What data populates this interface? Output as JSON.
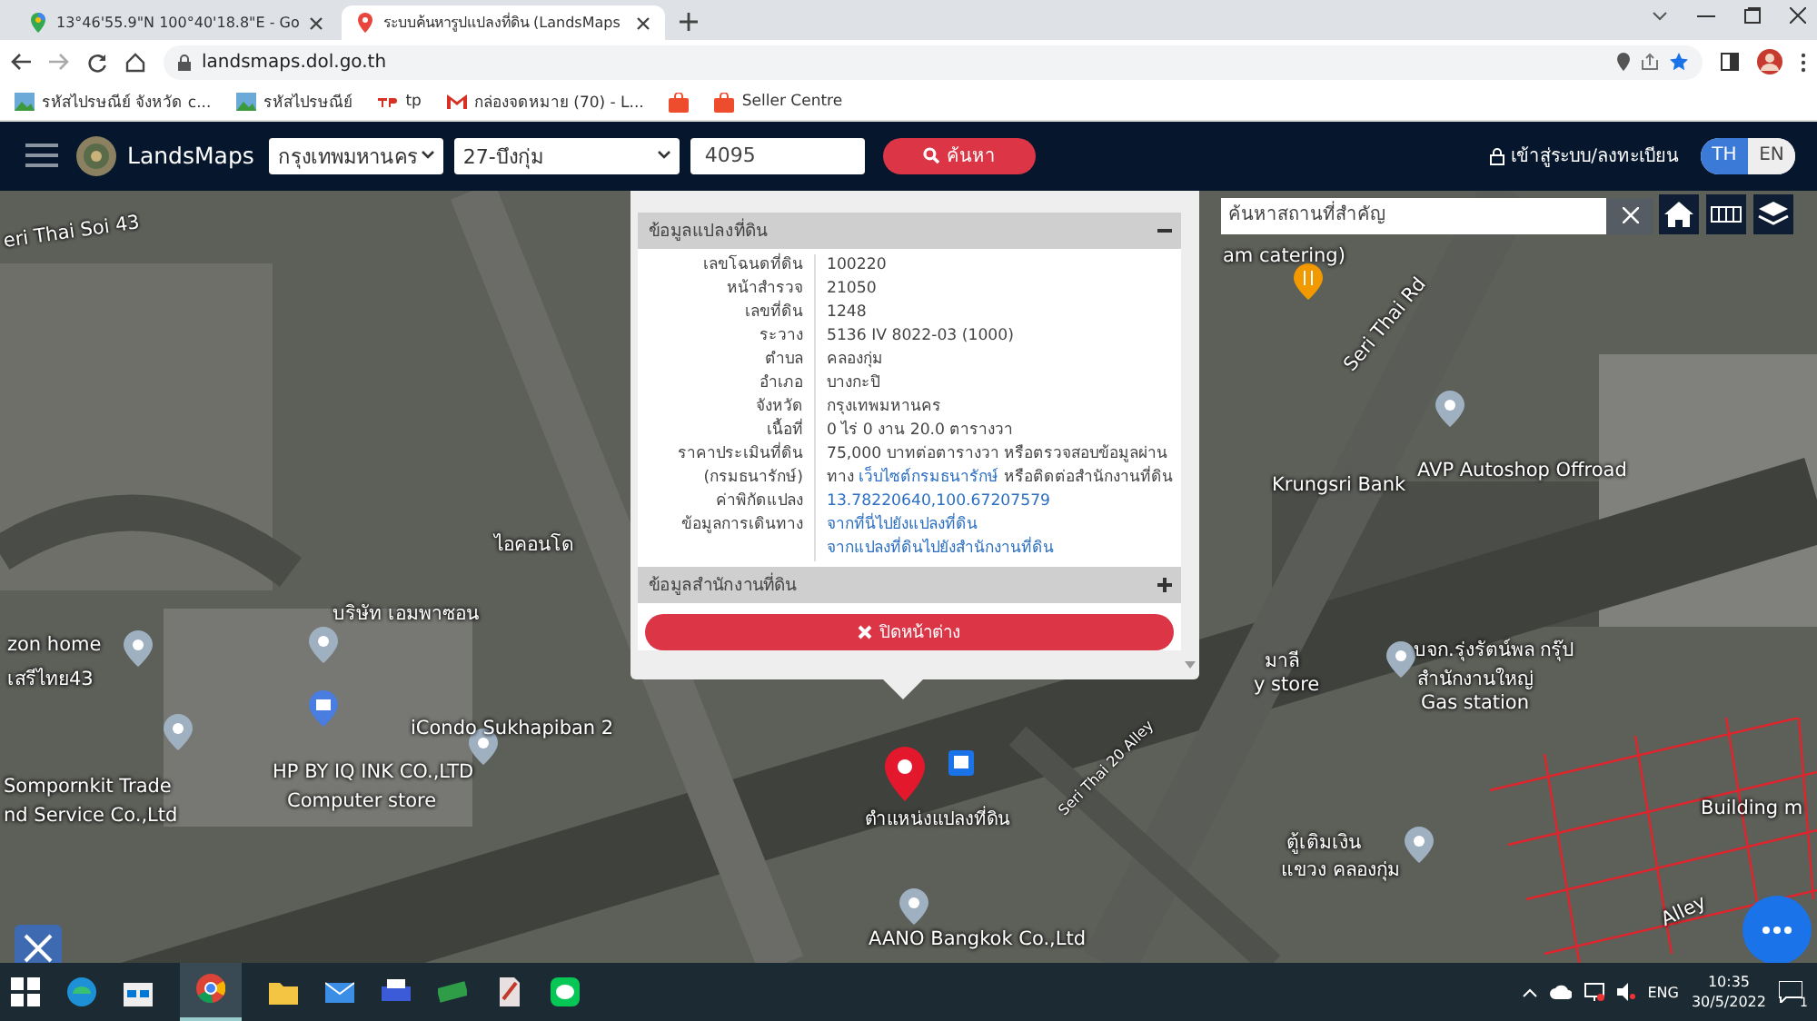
{
  "browser": {
    "tabs": [
      {
        "title": "13°46'55.9\"N 100°40'18.8\"E - Go",
        "selected": false
      },
      {
        "title": "ระบบค้นหารูปแปลงที่ดิน (LandsMaps",
        "selected": true
      }
    ],
    "url": "landsmaps.dol.go.th",
    "bookmarks": [
      {
        "label": "รหัสไปรษณีย์ จังหวัด c...",
        "kind": "image"
      },
      {
        "label": "รหัสไปรษณีย์",
        "kind": "image"
      },
      {
        "label": "tp",
        "kind": "tp"
      },
      {
        "label": "กล่องจดหมาย (70) - L...",
        "kind": "mail"
      },
      {
        "kind": "shop"
      },
      {
        "label": "Seller Centre",
        "kind": "shop"
      }
    ]
  },
  "app": {
    "brand": "LandsMaps",
    "province": "กรุงเทพมหานคร",
    "district": "27-บึงกุ่ม",
    "parcel_number": "4095",
    "search_button": "ค้นหา",
    "login": "เข้าสู่ระบบ/ลงทะเบียน",
    "languages": [
      {
        "label": "TH",
        "selected": true
      },
      {
        "label": "EN",
        "selected": false
      }
    ]
  },
  "map": {
    "search": {
      "placeholder": "ค้นหาสถานที่สำคัญ"
    },
    "labels": [
      {
        "text": "eri Thai Soi 43"
      },
      {
        "text": "am catering)"
      },
      {
        "text": "Seri Thai Rd"
      },
      {
        "text": "Krungsri Bank"
      },
      {
        "text": "AVP Autoshop Offroad"
      },
      {
        "text": "ไอคอนโด"
      },
      {
        "text": "บริษัท เอมพาซอน"
      },
      {
        "text": "zon home"
      },
      {
        "text": "เสรีไทย43"
      },
      {
        "text": "iCondo Sukhapiban 2"
      },
      {
        "text": "HP BY IQ INK CO.,LTD"
      },
      {
        "text": "Computer store"
      },
      {
        "text": "Sompornkit Trade"
      },
      {
        "text": "nd Service Co.,Ltd"
      },
      {
        "text": "มาลี"
      },
      {
        "text": "y store"
      },
      {
        "text": "บจก.รุ่งรัตน์พล กรุ๊ป"
      },
      {
        "text": "สำนักงานใหญ่"
      },
      {
        "text": "Gas station"
      },
      {
        "text": "Seri Thai 20 Alley"
      },
      {
        "text": "ตู้เติมเงิน"
      },
      {
        "text": "แขวง คลองกุ่ม"
      },
      {
        "text": "AANO Bangkok Co.,Ltd"
      },
      {
        "text": "Building m"
      },
      {
        "text": "Alley"
      }
    ],
    "marker_label": "ตำแหน่งแปลงที่ดิน"
  },
  "popup": {
    "sections": [
      {
        "title": "ข้อมูลแปลงที่ดิน",
        "expanded": true,
        "rows": [
          {
            "label": "เลขโฉนดที่ดิน",
            "value": [
              {
                "text": "100220",
                "link": false
              }
            ]
          },
          {
            "label": "หน้าสำรวจ",
            "value": [
              {
                "text": "21050",
                "link": false
              }
            ]
          },
          {
            "label": "เลขที่ดิน",
            "value": [
              {
                "text": "1248",
                "link": false
              }
            ]
          },
          {
            "label": "ระวาง",
            "value": [
              {
                "text": "5136 IV 8022-03 (1000)",
                "link": false
              }
            ]
          },
          {
            "label": "ตำบล",
            "value": [
              {
                "text": "คลองกุ่ม",
                "link": false
              }
            ]
          },
          {
            "label": "อำเภอ",
            "value": [
              {
                "text": "บางกะปิ",
                "link": false
              }
            ]
          },
          {
            "label": "จังหวัด",
            "value": [
              {
                "text": "กรุงเทพมหานคร",
                "link": false
              }
            ]
          },
          {
            "label": "เนื้อที่",
            "value": [
              {
                "text": "0 ไร่ 0 งาน 20.0 ตารางวา",
                "link": false
              }
            ]
          },
          {
            "label": "ราคาประเมินที่ดิน (กรมธนารักษ์)",
            "value": [
              {
                "text": "75,000 บาทต่อตารางวา หรือตรวจสอบข้อมูลผ่านทาง ",
                "link": false
              },
              {
                "text": "เว็บไซต์กรมธนารักษ์",
                "link": true
              },
              {
                "text": " หรือติดต่อสำนักงานที่ดิน",
                "link": false
              }
            ]
          },
          {
            "label": "ค่าพิกัดแปลง",
            "value": [
              {
                "text": "13.78220640,100.67207579",
                "link": true
              }
            ]
          },
          {
            "label": "ข้อมูลการเดินทาง",
            "value": [
              {
                "text": "จากที่นี่ไปยังแปลงที่ดิน",
                "link": true
              },
              {
                "text": "จากแปลงที่ดินไปยังสำนักงานที่ดิน",
                "link": true
              }
            ]
          }
        ]
      },
      {
        "title": "ข้อมูลสำนักงานที่ดิน",
        "expanded": false
      }
    ],
    "close_button": "ปิดหน้าต่าง"
  },
  "taskbar": {
    "language": "ENG",
    "time": "10:35",
    "date": "30/5/2022",
    "notifications": "1"
  }
}
